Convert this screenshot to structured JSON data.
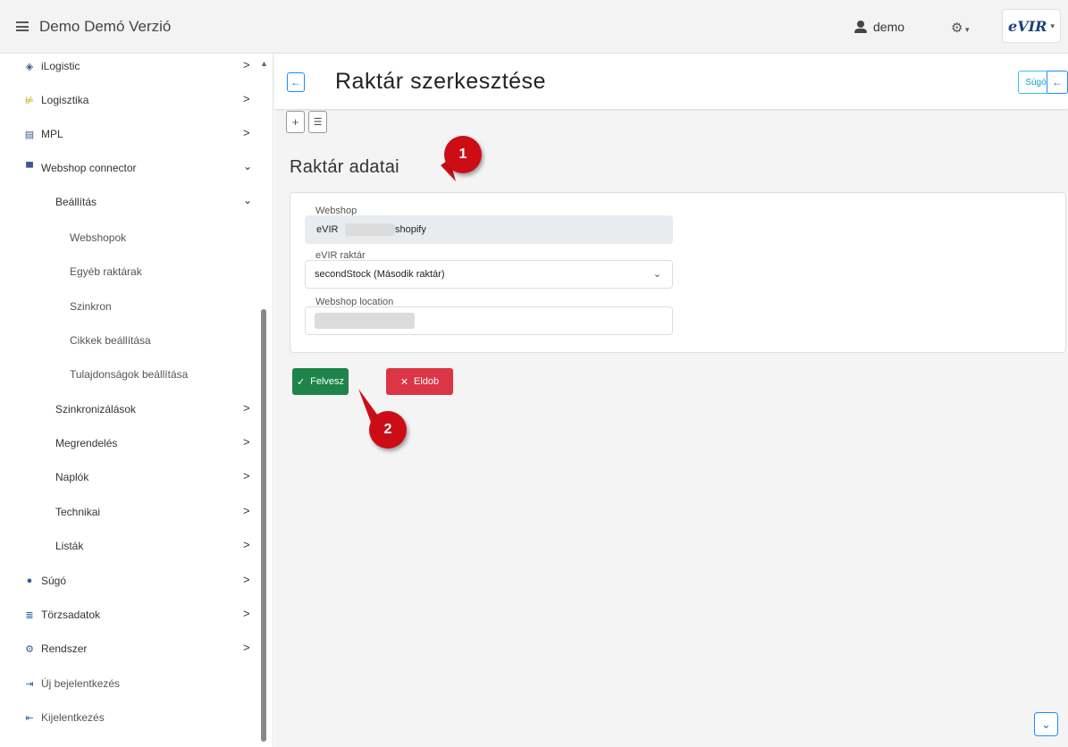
{
  "app": {
    "title": "Demo Demó Verzió"
  },
  "topbar": {
    "user": "demo",
    "logo": "eVIR"
  },
  "sidebar": {
    "items": [
      {
        "label": "iLogistic",
        "icon": "cube-icon"
      },
      {
        "label": "Logisztika",
        "icon": "hand-truck-icon"
      },
      {
        "label": "MPL",
        "icon": "truck-icon"
      },
      {
        "label": "Webshop connector",
        "icon": "cart-icon"
      },
      {
        "label": "Beállítás"
      },
      {
        "label": "Webshopok"
      },
      {
        "label": "Egyéb raktárak"
      },
      {
        "label": "Szinkron"
      },
      {
        "label": "Cikkek beállítása"
      },
      {
        "label": "Tulajdonságok beállítása"
      },
      {
        "label": "Szinkronizálások"
      },
      {
        "label": "Megrendelés"
      },
      {
        "label": "Naplók"
      },
      {
        "label": "Technikai"
      },
      {
        "label": "Listák"
      },
      {
        "label": "Súgó",
        "icon": "help-circle-icon"
      },
      {
        "label": "Törzsadatok",
        "icon": "database-icon"
      },
      {
        "label": "Rendszer",
        "icon": "cogs-icon"
      },
      {
        "label": "Új bejelentkezés",
        "icon": "login-icon"
      },
      {
        "label": "Kijelentkezés",
        "icon": "logout-icon"
      }
    ]
  },
  "page": {
    "title": "Raktár szerkesztése",
    "help_label": "Súgó",
    "section_title": "Raktár adatai"
  },
  "form": {
    "webshop_label": "Webshop",
    "webshop_value_prefix": "eVIR",
    "webshop_value_suffix": "shopify",
    "evir_stock_label": "eVIR raktár",
    "evir_stock_value": "secondStock (Második raktár)",
    "location_label": "Webshop location"
  },
  "actions": {
    "save_label": "Felvesz",
    "discard_label": "Eldob"
  },
  "annotations": {
    "callout1": "1",
    "callout2": "2"
  },
  "colors": {
    "save": "#1e8449",
    "discard": "#dc3545",
    "callout": "#cc0d16",
    "accent": "#1a8cff"
  }
}
